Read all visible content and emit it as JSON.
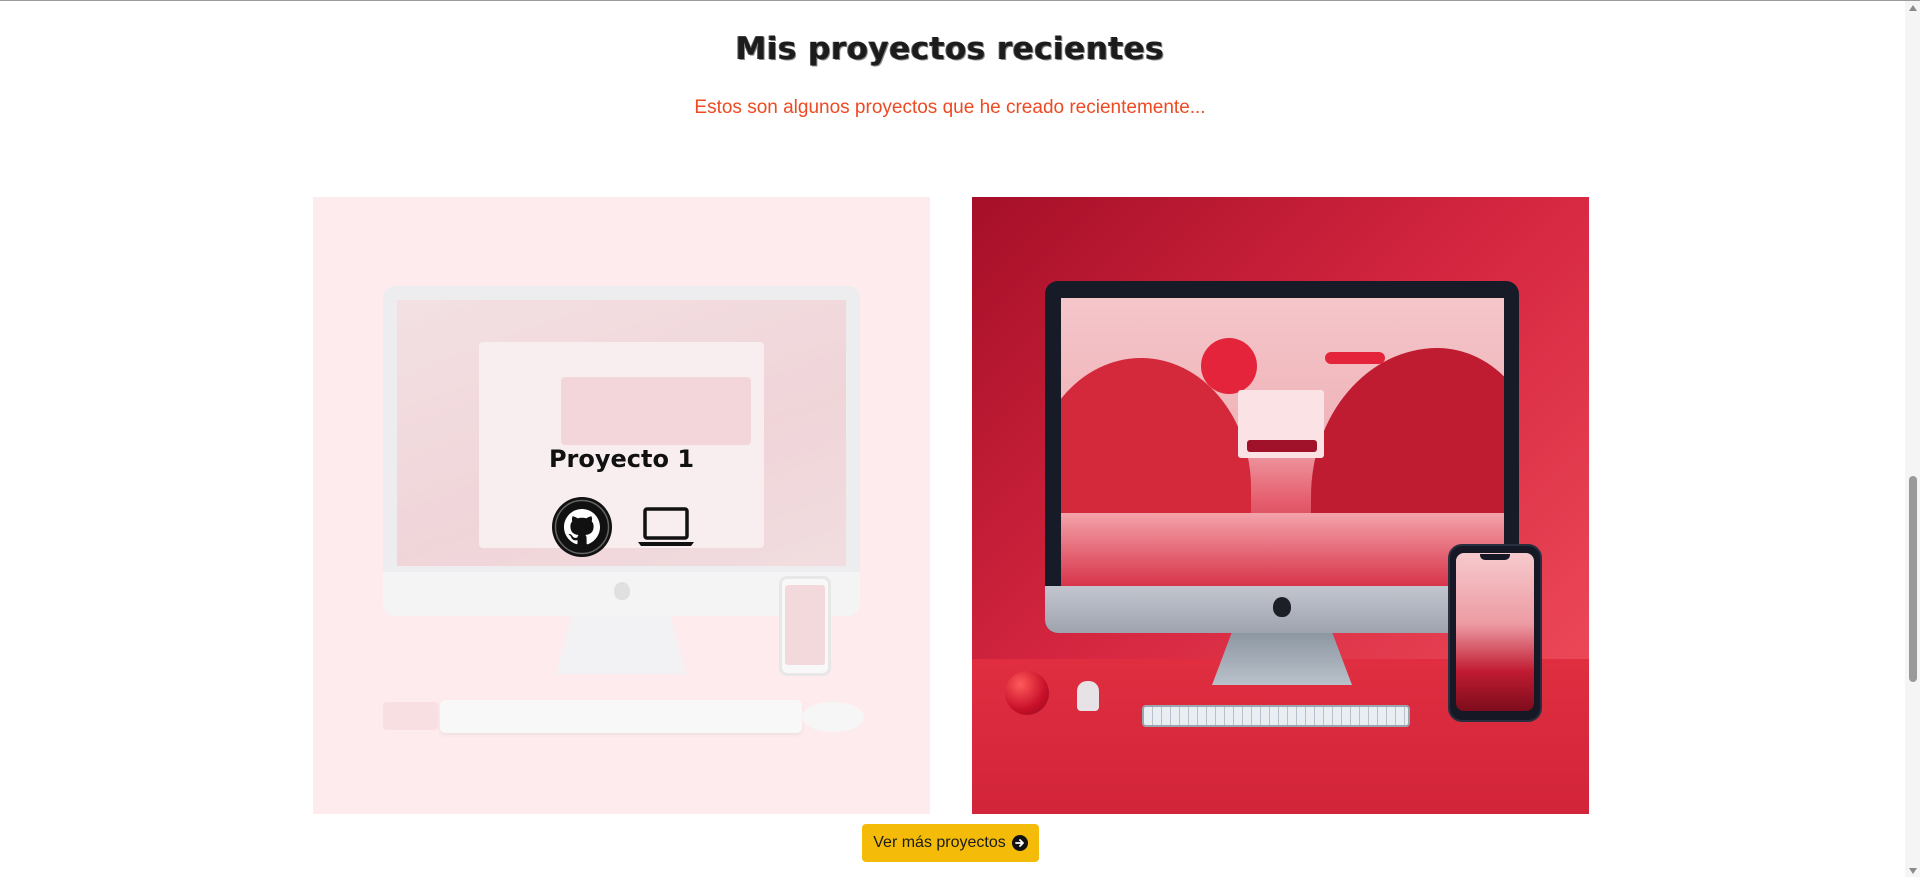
{
  "section": {
    "title": "Mis proyectos recientes",
    "subtitle": "Estos son algunos proyectos que he creado recientemente..."
  },
  "projects": [
    {
      "title": "Proyecto 1",
      "state": "hover-overlay",
      "links": [
        {
          "icon": "github-icon"
        },
        {
          "icon": "laptop-icon"
        }
      ]
    },
    {
      "title": "",
      "state": "default"
    }
  ],
  "more_button": {
    "label": "Ver más proyectos",
    "icon": "arrow-right-circle-icon"
  },
  "colors": {
    "title": "#1c1c1c",
    "subtitle": "#ee4a22",
    "button_bg": "#f4bc09",
    "card1_bg": "#fde0e3",
    "card2_accent": "#d52640"
  }
}
